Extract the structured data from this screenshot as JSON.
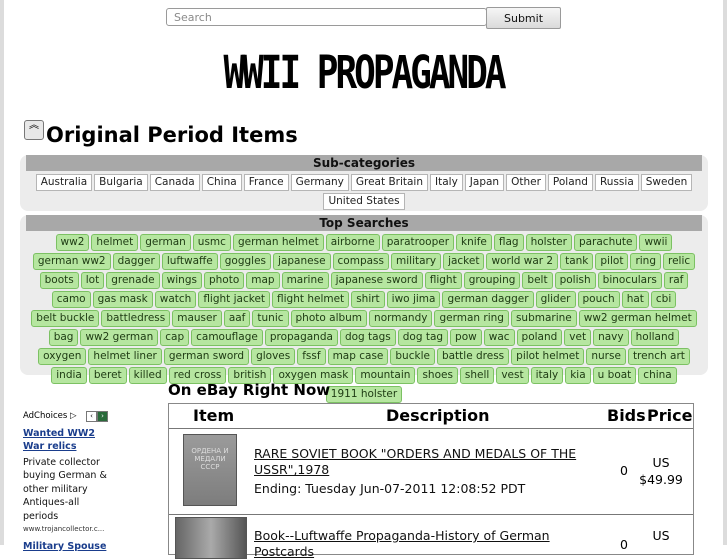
{
  "search": {
    "placeholder": "Search",
    "button_label": "Submit"
  },
  "site_title": "WWII PROPAGANDA",
  "section": {
    "title": "Original Period Items",
    "collapse_icon": "double-chevron-up-icon"
  },
  "subcategories": {
    "heading": "Sub-categories",
    "items": [
      "Australia",
      "Bulgaria",
      "Canada",
      "China",
      "France",
      "Germany",
      "Great Britain",
      "Italy",
      "Japan",
      "Other",
      "Poland",
      "Russia",
      "Sweden",
      "United States"
    ]
  },
  "top_searches": {
    "heading": "Top Searches",
    "items": [
      "ww2",
      "helmet",
      "german",
      "usmc",
      "german helmet",
      "airborne",
      "paratrooper",
      "knife",
      "flag",
      "holster",
      "parachute",
      "wwii",
      "german ww2",
      "dagger",
      "luftwaffe",
      "goggles",
      "japanese",
      "compass",
      "military",
      "jacket",
      "world war 2",
      "tank",
      "pilot",
      "ring",
      "relic",
      "boots",
      "lot",
      "grenade",
      "wings",
      "photo",
      "map",
      "marine",
      "japanese sword",
      "flight",
      "grouping",
      "belt",
      "polish",
      "binoculars",
      "raf",
      "camo",
      "gas mask",
      "watch",
      "flight jacket",
      "flight helmet",
      "shirt",
      "iwo jima",
      "german dagger",
      "glider",
      "pouch",
      "hat",
      "cbi",
      "belt buckle",
      "battledress",
      "mauser",
      "aaf",
      "tunic",
      "photo album",
      "normandy",
      "german ring",
      "submarine",
      "ww2 german helmet",
      "bag",
      "ww2 german",
      "cap",
      "camouflage",
      "propaganda",
      "dog tags",
      "dog tag",
      "pow",
      "wac",
      "poland",
      "vet",
      "navy",
      "holland",
      "oxygen",
      "helmet liner",
      "german sword",
      "gloves",
      "fssf",
      "map case",
      "buckle",
      "battle dress",
      "pilot helmet",
      "nurse",
      "trench art",
      "india",
      "beret",
      "killed",
      "red cross",
      "british",
      "oxygen mask",
      "mountain",
      "shoes",
      "shell",
      "vest",
      "italy",
      "kia",
      "u boat",
      "china",
      "1911 holster"
    ]
  },
  "ads": {
    "adchoices_label": "AdChoices",
    "ad1": {
      "title": "Wanted WW2 War relics",
      "body": "Private collector buying German & other military Antiques-all periods",
      "url": "www.trojancollector.c..."
    },
    "ad2": {
      "title": "Military Spouse"
    }
  },
  "ebay": {
    "title": "On eBay Right Now",
    "headers": {
      "item": "Item",
      "description": "Description",
      "bids": "Bids",
      "price": "Price"
    },
    "rows": [
      {
        "title": "RARE SOVIET BOOK \"ORDERS AND MEDALS OF THE USSR\",1978",
        "ending": "Ending: Tuesday Jun-07-2011 12:08:52 PDT",
        "bids": "0",
        "currency": "US",
        "price": "$49.99",
        "thumb_text": "ОРДЕНА И МЕДАЛИ СССР"
      },
      {
        "title": "Book--Luftwaffe Propaganda-History of German Postcards",
        "bids": "0",
        "currency": "US"
      }
    ]
  }
}
